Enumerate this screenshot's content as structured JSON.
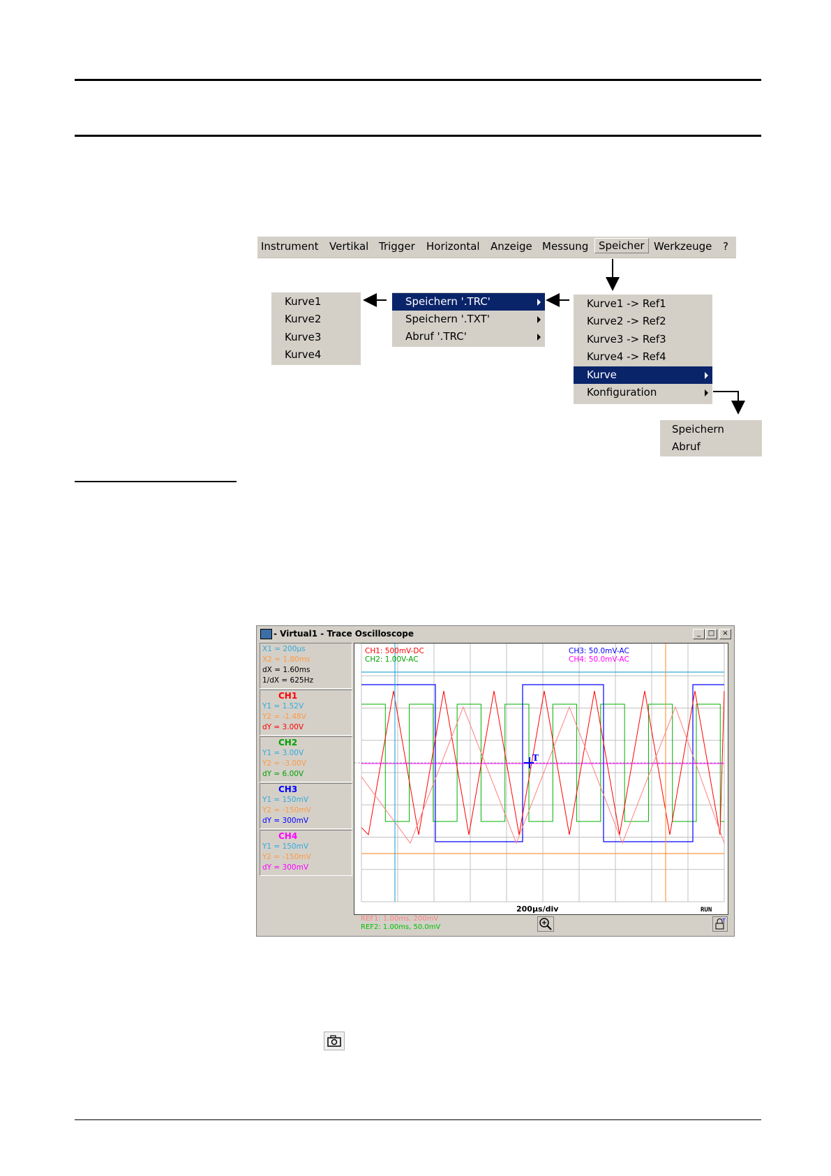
{
  "menu": {
    "items": [
      "Instrument",
      "Vertikal",
      "Trigger",
      "Horizontal",
      "Anzeige",
      "Messung",
      "Speicher",
      "Werkzeuge",
      "?"
    ],
    "selected": "Speicher"
  },
  "popup_kurve_list": [
    "Kurve1",
    "Kurve2",
    "Kurve3",
    "Kurve4"
  ],
  "popup_speichern": [
    {
      "label": "Speichern '.TRC'",
      "highlighted": true
    },
    {
      "label": "Speichern '.TXT'",
      "highlighted": false
    },
    {
      "label": "Abruf '.TRC'",
      "highlighted": false
    }
  ],
  "popup_speicher": [
    {
      "label": "Kurve1 -> Ref1",
      "submenu": false,
      "highlighted": false
    },
    {
      "label": "Kurve2 -> Ref2",
      "submenu": false,
      "highlighted": false
    },
    {
      "label": "Kurve3 -> Ref3",
      "submenu": false,
      "highlighted": false
    },
    {
      "label": "Kurve4 -> Ref4",
      "submenu": false,
      "highlighted": false
    },
    {
      "label": "Kurve",
      "submenu": true,
      "highlighted": true
    },
    {
      "label": "Konfiguration",
      "submenu": true,
      "highlighted": false
    }
  ],
  "popup_config": [
    "Speichern",
    "Abruf"
  ],
  "scope": {
    "title": "- Virtual1 - Trace Oscilloscope",
    "window_buttons": [
      "_",
      "□",
      "×"
    ],
    "cursor_box": {
      "x1": "X1 = 200µs",
      "x2": "X2 = 1.80ms",
      "dx": "dX = 1.60ms",
      "inv_dx": "1/dX = 625Hz"
    },
    "channels": [
      {
        "name": "CH1",
        "y1": "Y1 = 1.52V",
        "y2": "Y2 = -1.48V",
        "dy": "dY = 3.00V",
        "color": "#ff0000"
      },
      {
        "name": "CH2",
        "y1": "Y1 = 3.00V",
        "y2": "Y2 = -3.00V",
        "dy": "dY = 6.00V",
        "color": "#00a000"
      },
      {
        "name": "CH3",
        "y1": "Y1 = 150mV",
        "y2": "Y2 = -150mV",
        "dy": "dY = 300mV",
        "color": "#0000ff"
      },
      {
        "name": "CH4",
        "y1": "Y1 = 150mV",
        "y2": "Y2 = -150mV",
        "dy": "dY = 300mV",
        "color": "#ff00ff"
      }
    ],
    "plot_labels": {
      "ch1": "CH1: 500mV-DC",
      "ch2": "CH2: 1.00V-AC",
      "ch3": "CH3: 50.0mV-AC",
      "ch4": "CH4: 50.0mV-AC"
    },
    "timebase": "200µs/div",
    "run": "RUN",
    "ref1": "REF1: 1.00ms, 200mV",
    "ref2": "REF2: 1.00ms, 50.0mV",
    "colors": {
      "cursor_x": "#33aadd",
      "cursor_y": "#ff9944",
      "ch1": "#ff0000",
      "ch2": "#00b000",
      "ch3": "#0000ff",
      "ch4": "#ff00ff",
      "ref1": "#ff8080"
    }
  },
  "icons": [
    "camera-icon",
    "zoom-icon",
    "lock-icon"
  ]
}
